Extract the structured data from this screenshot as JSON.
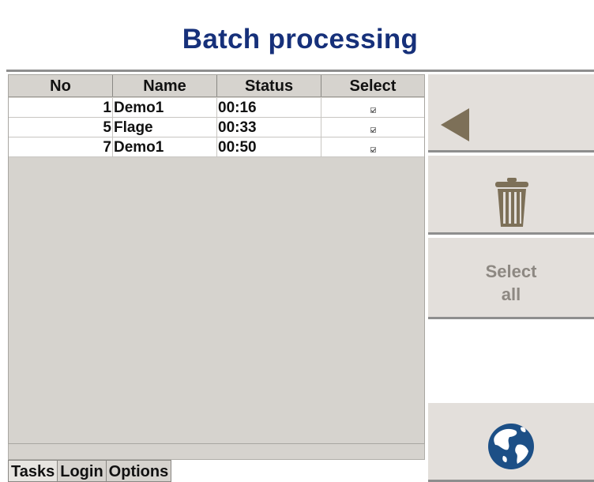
{
  "header": {
    "title": "Batch processing"
  },
  "table": {
    "columns": [
      "No",
      "Name",
      "Status",
      "Select"
    ],
    "rows": [
      {
        "no": "1",
        "name": "Demo1",
        "status": "00:16",
        "selected": true
      },
      {
        "no": "5",
        "name": "Flage",
        "status": "00:33",
        "selected": true
      },
      {
        "no": "7",
        "name": "Demo1",
        "status": "00:50",
        "selected": true
      }
    ]
  },
  "tabs": [
    "Tasks",
    "Login",
    "Options"
  ],
  "active_tab": "Tasks",
  "sidebar": {
    "back_icon": "back-triangle-icon",
    "delete_icon": "trash-icon",
    "select_all_line1": "Select",
    "select_all_line2": "all",
    "globe_icon": "globe-icon"
  },
  "colors": {
    "title": "#16307a",
    "panel": "#d6d3ce",
    "button": "#e3dfdb",
    "icon": "#7d7058",
    "globe": "#1c4f86"
  }
}
